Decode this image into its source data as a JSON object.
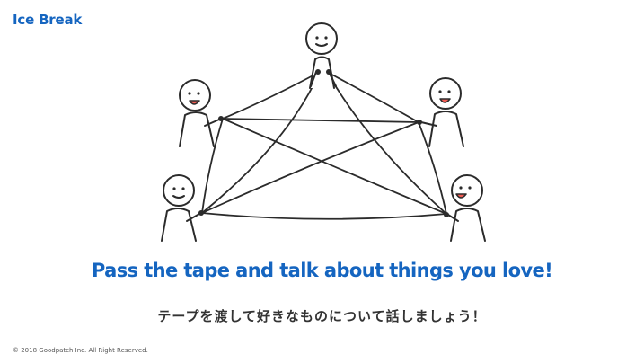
{
  "slide": {
    "section_label": "Ice Break",
    "headline": "Pass the tape and talk about things you love!",
    "subheadline": "テープを渡して好きなものについて話しましょう！",
    "copyright": "© 2018 Goodpatch Inc. All Right Reserved."
  },
  "colors": {
    "accent": "#1565c0",
    "text": "#333333",
    "outline": "#2b2b2b",
    "mouth": "#f25c54"
  },
  "illustration": {
    "people_count": 5,
    "icon": "people-passing-tape-illustration"
  }
}
